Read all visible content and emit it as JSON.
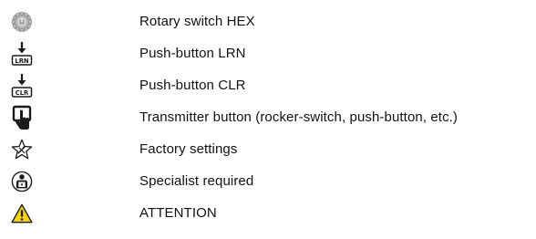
{
  "legend": {
    "items": [
      {
        "icon": "rotary-switch-icon",
        "label": "Rotary switch HEX"
      },
      {
        "icon": "push-button-lrn-icon",
        "icon_text": "LRN",
        "label": "Push-button LRN"
      },
      {
        "icon": "push-button-clr-icon",
        "icon_text": "CLR",
        "label": "Push-button CLR"
      },
      {
        "icon": "transmitter-button-icon",
        "label": "Transmitter button (rocker-switch, push-button, etc.)"
      },
      {
        "icon": "factory-settings-icon",
        "label": "Factory settings"
      },
      {
        "icon": "specialist-required-icon",
        "label": "Specialist required"
      },
      {
        "icon": "warning-icon",
        "label": "ATTENTION"
      }
    ]
  },
  "colors": {
    "icon_dark": "#1a1a1a",
    "icon_gray": "#8a8a8a",
    "warning_yellow": "#f5d300"
  }
}
